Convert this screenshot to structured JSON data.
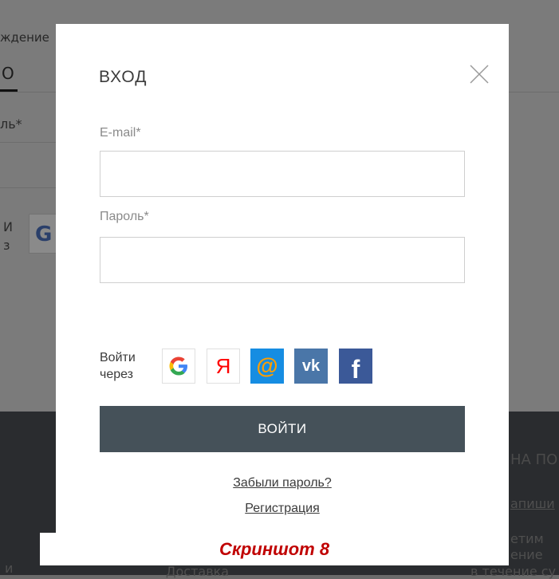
{
  "background": {
    "text_birth": "ждение",
    "text_tab": "О",
    "text_password_fragment": "ль*",
    "text_via_line1": "И",
    "text_via_line2": "з",
    "google_letter": "G",
    "right_heading": "НА ПО",
    "right_link": "апиши",
    "right_text1": "етим",
    "right_text2": "ение",
    "right_text3": "в течение су",
    "bottom_left": "и",
    "bottom_center": "Доставка"
  },
  "modal": {
    "title": "ВХОД",
    "email_label": "E-mail*",
    "email_value": "",
    "password_label": "Пароль*",
    "password_value": "",
    "social_label_line1": "Войти",
    "social_label_line2": "через",
    "social": [
      {
        "name": "google",
        "glyph": "G"
      },
      {
        "name": "yandex",
        "glyph": "Я"
      },
      {
        "name": "mailru",
        "glyph": "@"
      },
      {
        "name": "vk",
        "glyph": "vk"
      },
      {
        "name": "facebook",
        "glyph": "f"
      }
    ],
    "submit_label": "ВОЙТИ",
    "forgot_link": "Забыли пароль?",
    "register_link": "Регистрация"
  },
  "caption": "Скриншот 8",
  "colors": {
    "overlay": "#7b7b7b",
    "footer": "#2a2c2f",
    "submit": "#455159",
    "mail": "#168de2",
    "vk": "#4a76a8",
    "facebook": "#3b5998",
    "caption_text": "#c00000"
  }
}
